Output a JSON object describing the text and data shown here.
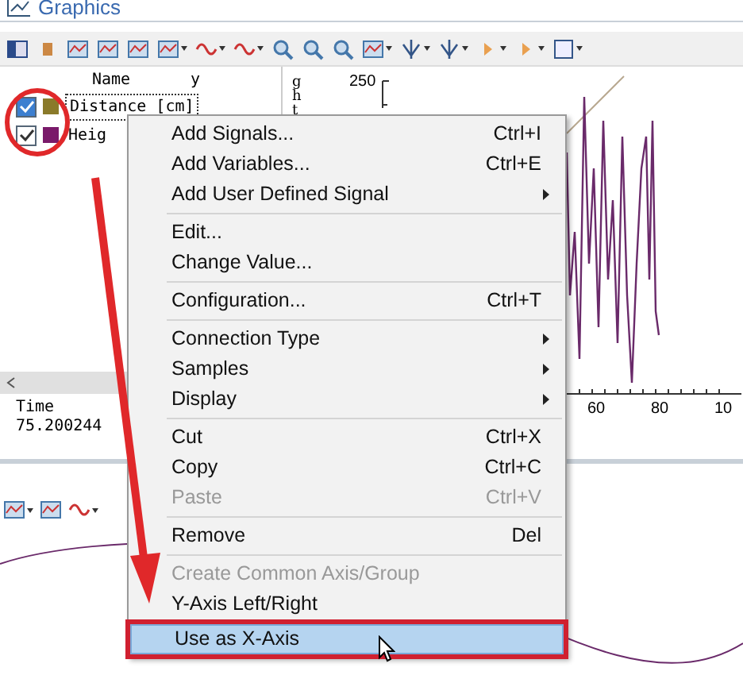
{
  "window": {
    "title": "Graphics"
  },
  "signal_list": {
    "columns": [
      "Name",
      "y"
    ],
    "rows": [
      {
        "name": "Distance [cm]",
        "checked": true,
        "selected": true,
        "color": "#8a7a2a"
      },
      {
        "name": "Heig",
        "checked": true,
        "selected": false,
        "color": "#7a1a6a"
      }
    ],
    "time_label": "Time",
    "time_value": "75.200244"
  },
  "chart": {
    "y_label": "ght",
    "y_tick": "250",
    "x_ticks": [
      "60",
      "80",
      "10"
    ]
  },
  "context_menu": [
    {
      "kind": "item",
      "label": "Add Signals...",
      "shortcut": "Ctrl+I",
      "submenu": false,
      "disabled": false,
      "selected": false
    },
    {
      "kind": "item",
      "label": "Add Variables...",
      "shortcut": "Ctrl+E",
      "submenu": false,
      "disabled": false,
      "selected": false
    },
    {
      "kind": "item",
      "label": "Add User Defined Signal",
      "submenu": true,
      "disabled": false,
      "selected": false
    },
    {
      "kind": "separator"
    },
    {
      "kind": "item",
      "label": "Edit...",
      "submenu": false,
      "disabled": false,
      "selected": false
    },
    {
      "kind": "item",
      "label": "Change Value...",
      "submenu": false,
      "disabled": false,
      "selected": false
    },
    {
      "kind": "separator"
    },
    {
      "kind": "item",
      "label": "Configuration...",
      "shortcut": "Ctrl+T",
      "submenu": false,
      "disabled": false,
      "selected": false
    },
    {
      "kind": "separator"
    },
    {
      "kind": "item",
      "label": "Connection Type",
      "submenu": true,
      "disabled": false,
      "selected": false
    },
    {
      "kind": "item",
      "label": "Samples",
      "submenu": true,
      "disabled": false,
      "selected": false
    },
    {
      "kind": "item",
      "label": "Display",
      "submenu": true,
      "disabled": false,
      "selected": false
    },
    {
      "kind": "separator"
    },
    {
      "kind": "item",
      "label": "Cut",
      "shortcut": "Ctrl+X",
      "submenu": false,
      "disabled": false,
      "selected": false
    },
    {
      "kind": "item",
      "label": "Copy",
      "shortcut": "Ctrl+C",
      "submenu": false,
      "disabled": false,
      "selected": false
    },
    {
      "kind": "item",
      "label": "Paste",
      "shortcut": "Ctrl+V",
      "submenu": false,
      "disabled": true,
      "selected": false
    },
    {
      "kind": "separator"
    },
    {
      "kind": "item",
      "label": "Remove",
      "shortcut": "Del",
      "submenu": false,
      "disabled": false,
      "selected": false
    },
    {
      "kind": "separator"
    },
    {
      "kind": "item",
      "label": "Create Common Axis/Group",
      "submenu": false,
      "disabled": true,
      "selected": false
    },
    {
      "kind": "item",
      "label": "Y-Axis Left/Right",
      "submenu": false,
      "disabled": false,
      "selected": false
    },
    {
      "kind": "item",
      "label": "Use as X-Axis",
      "submenu": false,
      "disabled": false,
      "selected": true
    }
  ]
}
